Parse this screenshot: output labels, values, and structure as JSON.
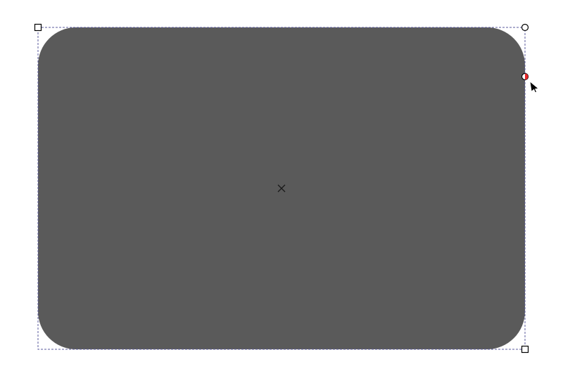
{
  "canvas": {
    "background": "#ffffff"
  },
  "shape": {
    "type": "rounded-rectangle",
    "fill": "#5a5a5a",
    "selected": true
  },
  "selection": {
    "bbox_stroke": "#5b5b9e",
    "handle_fill": "#ffffff",
    "handle_stroke": "#000000",
    "active_handle_fill": "#e8282a"
  },
  "icons": {
    "center_marker": "center-cross-icon",
    "cursor": "mouse-pointer-icon"
  }
}
